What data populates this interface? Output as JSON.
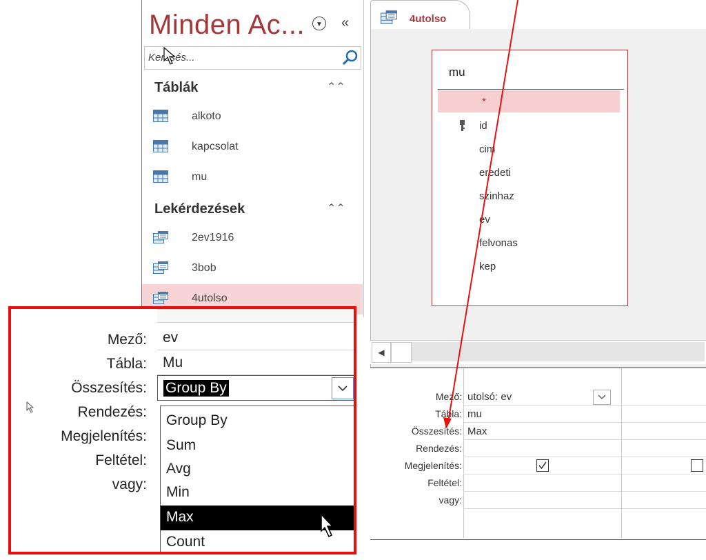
{
  "nav": {
    "title": "Minden Ac...",
    "search_placeholder": "Keresés...",
    "groups": [
      {
        "label": "Táblák",
        "items": [
          "alkoto",
          "kapcsolat",
          "mu"
        ]
      },
      {
        "label": "Lekérdezések",
        "items": [
          "2ev1916",
          "3bob",
          "4utolso"
        ]
      }
    ]
  },
  "tab": {
    "label": "4utolso"
  },
  "table_box": {
    "name": "mu",
    "fields": [
      "*",
      "id",
      "cim",
      "eredeti",
      "szinhaz",
      "ev",
      "felvonas",
      "kep"
    ]
  },
  "grid": {
    "row_labels": [
      "Mező:",
      "Tábla:",
      "Összesítés:",
      "Rendezés:",
      "Megjelenítés:",
      "Feltétel:",
      "vagy:"
    ],
    "column1": {
      "field": "utolsó: ev",
      "table": "mu",
      "total": "Max",
      "show": true
    },
    "column2": {
      "show": false
    }
  },
  "zoom": {
    "row_labels": [
      "Mező:",
      "Tábla:",
      "Összesítés:",
      "Rendezés:",
      "Megjelenítés:",
      "Feltétel:",
      "vagy:"
    ],
    "field_value": "ev",
    "table_value": "Mu",
    "total_value": "Group By",
    "options": [
      "Group By",
      "Sum",
      "Avg",
      "Min",
      "Max",
      "Count"
    ],
    "highlighted_option": "Max"
  },
  "colors": {
    "accent": "#a4373a",
    "selection": "#f7d5d6",
    "annotation": "#e8100c"
  }
}
